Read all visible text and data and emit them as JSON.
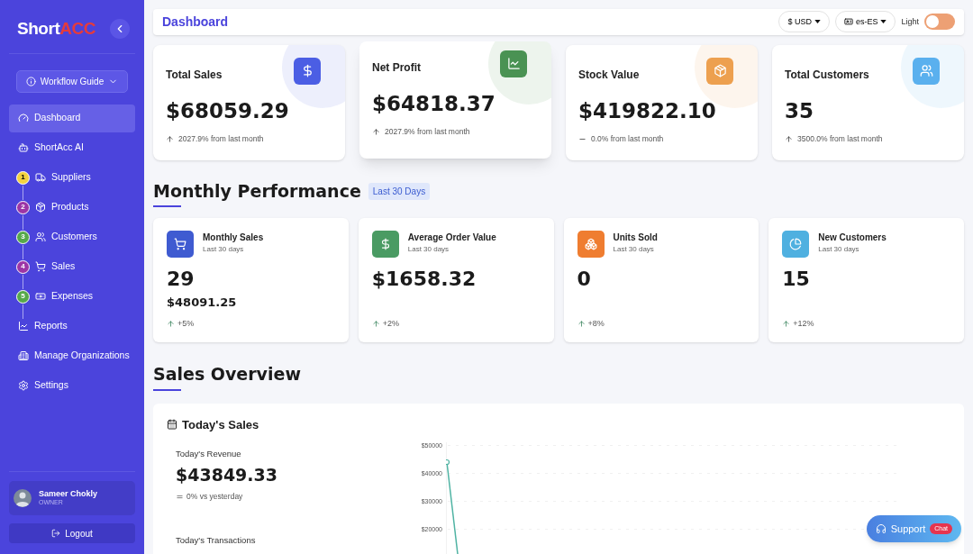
{
  "sidebar": {
    "logo": [
      "Short",
      "ACC"
    ],
    "guide_button": "Workflow Guide",
    "items": [
      {
        "label": "Dashboard",
        "kind": "plain",
        "selected": true
      },
      {
        "label": "ShortAcc AI",
        "kind": "plain",
        "selected": false
      },
      {
        "label": "Suppliers",
        "kind": "step",
        "step": "1",
        "color": "#f3d23e",
        "selected": false
      },
      {
        "label": "Products",
        "kind": "step",
        "step": "2",
        "color": "#9c35a6",
        "selected": false
      },
      {
        "label": "Customers",
        "kind": "step",
        "step": "3",
        "color": "#56a84a",
        "selected": false
      },
      {
        "label": "Sales",
        "kind": "step",
        "step": "4",
        "color": "#9c35a6",
        "selected": false
      },
      {
        "label": "Expenses",
        "kind": "step",
        "step": "5",
        "color": "#56a84a",
        "selected": false
      },
      {
        "label": "Reports",
        "kind": "plain",
        "selected": false
      },
      {
        "label": "Manage Organizations",
        "kind": "plain",
        "selected": false
      },
      {
        "label": "Settings",
        "kind": "plain",
        "selected": false
      }
    ],
    "user": {
      "name": "Sameer Chokly",
      "role": "OWNER"
    },
    "logout": "Logout"
  },
  "header": {
    "title": "Dashboard",
    "currency": "$ USD",
    "locale": "es-ES",
    "theme_label": "Light",
    "on": false
  },
  "stats": [
    {
      "label": "Total Sales",
      "value": "$68059.29",
      "kind": "up",
      "change": "2027.9% from last month",
      "color": "#4b5ee4",
      "selected": false
    },
    {
      "label": "Net Profit",
      "value": "$64818.37",
      "kind": "up",
      "change": "2027.9% from last month",
      "color": "#4a9253",
      "selected": true
    },
    {
      "label": "Stock Value",
      "value": "$419822.10",
      "kind": "flat",
      "change": "0.0% from last month",
      "color": "#eda04f",
      "selected": false
    },
    {
      "label": "Total Customers",
      "value": "35",
      "kind": "up",
      "change": "3500.0% from last month",
      "color": "#5ab0ee",
      "selected": false
    }
  ],
  "monthly": {
    "title": "Monthly Performance",
    "badge": "Last 30 Days",
    "cards": [
      {
        "label": "Monthly Sales",
        "period": "Last 30 days",
        "value": "29",
        "secondary": "$48091.25",
        "change": "+5%",
        "color": "#3f5bd1"
      },
      {
        "label": "Average Order Value",
        "period": "Last 30 days",
        "value": "$1658.32",
        "change": "+2%",
        "color": "#4a9b63"
      },
      {
        "label": "Units Sold",
        "period": "Last 30 days",
        "value": "0",
        "change": "+8%",
        "color": "#ef7d30"
      },
      {
        "label": "New Customers",
        "period": "Last 30 days",
        "value": "15",
        "change": "+12%",
        "color": "#4fb0e0"
      }
    ]
  },
  "overview": {
    "title": "Sales Overview",
    "card_title": "Today's Sales",
    "revenue_label": "Today's Revenue",
    "revenue": "$43849.33",
    "revenue_change": "0% vs yesterday",
    "transactions_label": "Today's Transactions",
    "chart": {
      "y_labels": [
        "$50000",
        "$40000",
        "$30000",
        "$20000"
      ]
    }
  },
  "support": {
    "label": "Support",
    "badge": "Chat"
  }
}
